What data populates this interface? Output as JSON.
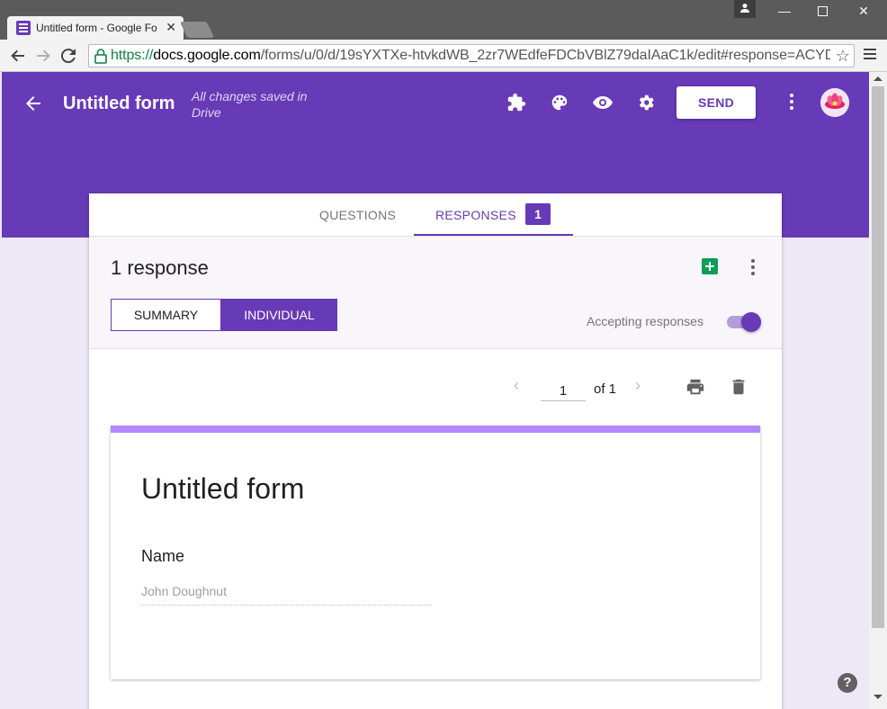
{
  "browser": {
    "tab_title": "Untitled form - Google Fo",
    "url_scheme": "https://",
    "url_host": "docs.google.com",
    "url_path": "/forms/u/0/d/19sYXTXe-htvkdWB_2zr7WEdfeFDCbVBlZ79daIAaC1k/edit#response=ACYD"
  },
  "header": {
    "form_title": "Untitled form",
    "saved_note": "All changes saved in Drive",
    "send_label": "SEND",
    "icons": [
      "puzzle-icon",
      "palette-icon",
      "eye-icon",
      "gear-icon"
    ]
  },
  "tabs": {
    "questions_label": "QUESTIONS",
    "responses_label": "RESPONSES",
    "responses_count": "1"
  },
  "responses": {
    "count_text": "1 response",
    "summary_label": "SUMMARY",
    "individual_label": "INDIVIDUAL",
    "accepting_label": "Accepting responses",
    "accepting_on": true
  },
  "pager": {
    "current_page": "1",
    "of_total": "of 1"
  },
  "response_card": {
    "title": "Untitled form",
    "question": "Name",
    "answer": "John Doughnut"
  },
  "colors": {
    "brand": "#673ab7",
    "card_accent": "#b388ff",
    "background": "#ede7f6",
    "sheets_green": "#0f9d58"
  }
}
